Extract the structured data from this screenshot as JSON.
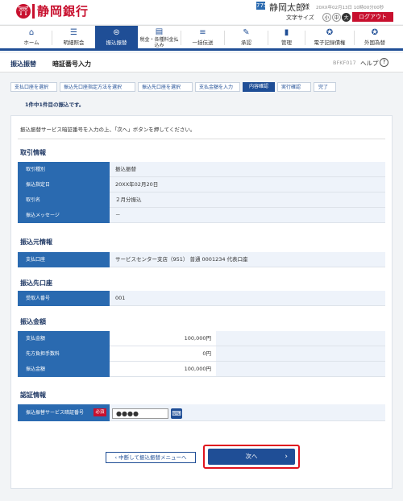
{
  "header": {
    "bank_name": "静岡銀行",
    "user_badge": "775",
    "user_name": "静岡太郎",
    "user_honorific": "様",
    "login_time": "20XX年02月13日 10時00分00秒",
    "font_size_label": "文字サイズ",
    "font_sizes": [
      "小",
      "中",
      "大"
    ],
    "logout_label": "ログアウト"
  },
  "nav": [
    {
      "label": "ホーム",
      "icon": "home-icon"
    },
    {
      "label": "明細照会",
      "icon": "list-icon"
    },
    {
      "label": "振込振替",
      "icon": "transfer-icon"
    },
    {
      "label": "税金・各種料金払込み",
      "icon": "payment-icon"
    },
    {
      "label": "一括伝送",
      "icon": "batch-icon"
    },
    {
      "label": "承認",
      "icon": "approve-icon"
    },
    {
      "label": "管理",
      "icon": "manage-icon"
    },
    {
      "label": "電子記録債権",
      "icon": "claim-icon"
    },
    {
      "label": "外国為替",
      "icon": "forex-icon"
    }
  ],
  "page": {
    "category": "振込振替",
    "title": "暗証番号入力",
    "screen_code": "BFKF017",
    "help_label": "ヘルプ"
  },
  "steps": [
    "支払口座を選択",
    "振込先口座指定方法を選択",
    "振込先口座を選択",
    "支払金額を入力",
    "内容確認",
    "実行確認",
    "完了"
  ],
  "notice": "1件中1件目の振込です。",
  "instruction": "振込振替サービス暗証番号を入力の上、「次へ」ボタンを押してください。",
  "sections": {
    "transaction": {
      "title": "取引情報",
      "rows": [
        {
          "label": "取引種別",
          "value": "振込振替"
        },
        {
          "label": "振込指定日",
          "value": "20XX年02月20日"
        },
        {
          "label": "取引名",
          "value": "２月分振込"
        },
        {
          "label": "振込メッセージ",
          "value": "－"
        }
      ]
    },
    "source": {
      "title": "振込元情報",
      "rows": [
        {
          "label": "支払口座",
          "value": "サービスセンター支店（951）  普通  0001234  代表口座"
        }
      ]
    },
    "dest": {
      "title": "振込先口座",
      "rows": [
        {
          "label": "受取人番号",
          "value": "001"
        }
      ]
    },
    "amount": {
      "title": "振込金額",
      "rows": [
        {
          "label": "支払金額",
          "value": "100,000円"
        },
        {
          "label": "先方負担手数料",
          "value": "0円"
        },
        {
          "label": "振込金額",
          "value": "100,000円"
        }
      ]
    },
    "auth": {
      "title": "認証情報",
      "label": "振込振替サービス暗証番号",
      "required": "必須",
      "password_value": "●●●●"
    }
  },
  "buttons": {
    "back": "中断して振込振替メニューへ",
    "next": "次へ"
  }
}
